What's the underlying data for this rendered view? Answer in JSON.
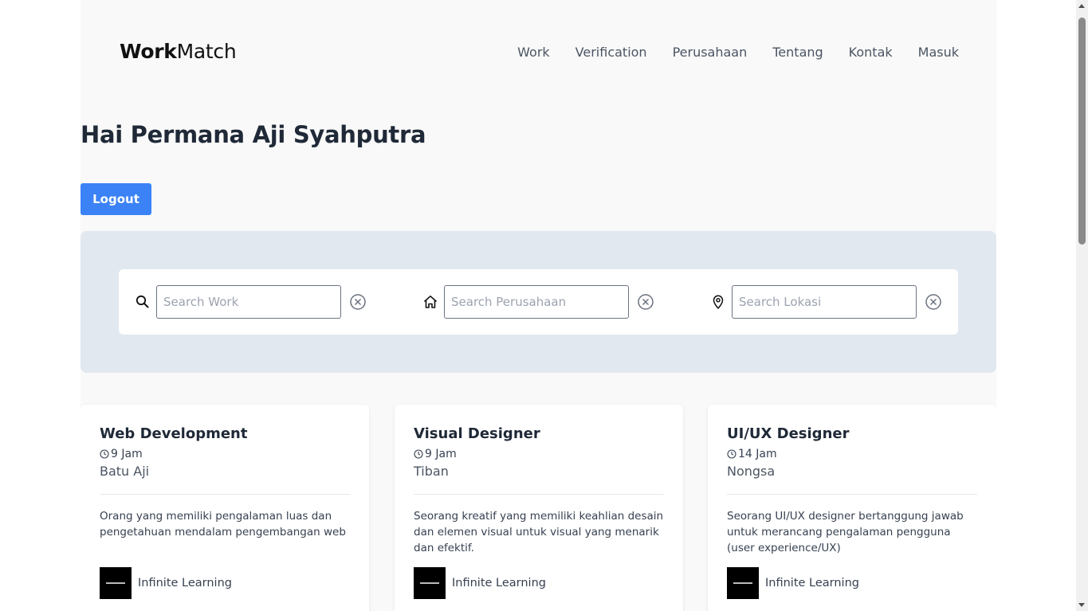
{
  "brand": {
    "bold": "Work",
    "light": "Match"
  },
  "nav": {
    "items": [
      {
        "label": "Work"
      },
      {
        "label": "Verification"
      },
      {
        "label": "Perusahaan"
      },
      {
        "label": "Tentang"
      },
      {
        "label": "Kontak"
      },
      {
        "label": "Masuk"
      }
    ]
  },
  "greeting": "Hai Permana Aji Syahputra",
  "logout_label": "Logout",
  "search": {
    "work": {
      "placeholder": "Search Work",
      "value": "",
      "icon": "search-icon"
    },
    "company": {
      "placeholder": "Search Perusahaan",
      "value": "",
      "icon": "home-icon"
    },
    "location": {
      "placeholder": "Search Lokasi",
      "value": "",
      "icon": "map-pin-icon"
    }
  },
  "jobs": [
    {
      "title": "Web Development",
      "hours": "9 Jam",
      "location": "Batu Aji",
      "description": "Orang yang memiliki pengalaman luas dan pengetahuan mendalam pengembangan web",
      "company": "Infinite Learning"
    },
    {
      "title": "Visual Designer",
      "hours": "9 Jam",
      "location": "Tiban",
      "description": "Seorang kreatif yang memiliki keahlian desain dan elemen visual untuk visual yang menarik dan efektif.",
      "company": "Infinite Learning"
    },
    {
      "title": "UI/UX Designer",
      "hours": "14 Jam",
      "location": "Nongsa",
      "description": "Seorang UI/UX designer bertanggung jawab untuk merancang pengalaman pengguna (user experience/UX)",
      "company": "Infinite Learning"
    }
  ],
  "colors": {
    "accent": "#3b82f6",
    "panel": "#e2e8f0",
    "page_bg": "#f9f9f9"
  }
}
